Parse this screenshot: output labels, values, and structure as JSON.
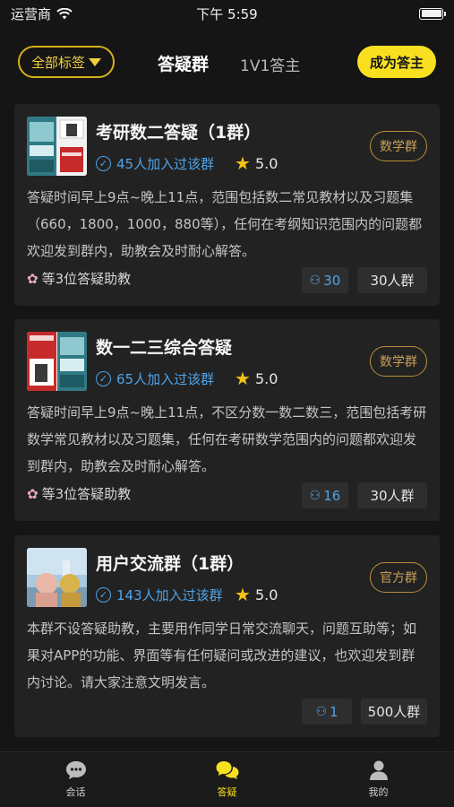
{
  "status_bar": {
    "carrier": "运营商",
    "time": "下午 5:59"
  },
  "header": {
    "tag_filter": "全部标签",
    "tabs": [
      {
        "label": "答疑群"
      },
      {
        "label": "1V1答主"
      }
    ],
    "become_button": "成为答主"
  },
  "groups": [
    {
      "title": "考研数二答疑（1群）",
      "joined": "45人加入过该群",
      "rating": "5.0",
      "type": "数学群",
      "description": "答疑时间早上9点~晚上11点，范围包括数二常见教材以及习题集（660，1800，1000，880等），任何在考纲知识范围内的问题都欢迎发到群内，助教会及时耐心解答。",
      "assistants": "等3位答疑助教",
      "member_count": "30",
      "group_size": "30人群"
    },
    {
      "title": "数一二三综合答疑",
      "joined": "65人加入过该群",
      "rating": "5.0",
      "type": "数学群",
      "description": "答疑时间早上9点~晚上11点，不区分数一数二数三，范围包括考研数学常见教材以及习题集，任何在考研数学范围内的问题都欢迎发到群内，助教会及时耐心解答。",
      "assistants": "等3位答疑助教",
      "member_count": "16",
      "group_size": "30人群"
    },
    {
      "title": "用户交流群（1群）",
      "joined": "143人加入过该群",
      "rating": "5.0",
      "type": "官方群",
      "description": "本群不设答疑助教，主要用作同学日常交流聊天，问题互助等；如果对APP的功能、界面等有任何疑问或改进的建议，也欢迎发到群内讨论。请大家注意文明发言。",
      "member_count": "1",
      "group_size": "500人群"
    }
  ],
  "tabbar": [
    {
      "label": "会话",
      "icon": "chat-bubble-icon"
    },
    {
      "label": "答疑",
      "icon": "qa-bubbles-icon"
    },
    {
      "label": "我的",
      "icon": "person-icon"
    }
  ],
  "colors": {
    "accent": "#f8df1f",
    "link": "#4fa3e8",
    "badge_border": "#b78f3a",
    "background": "#151515",
    "card": "#222222"
  }
}
